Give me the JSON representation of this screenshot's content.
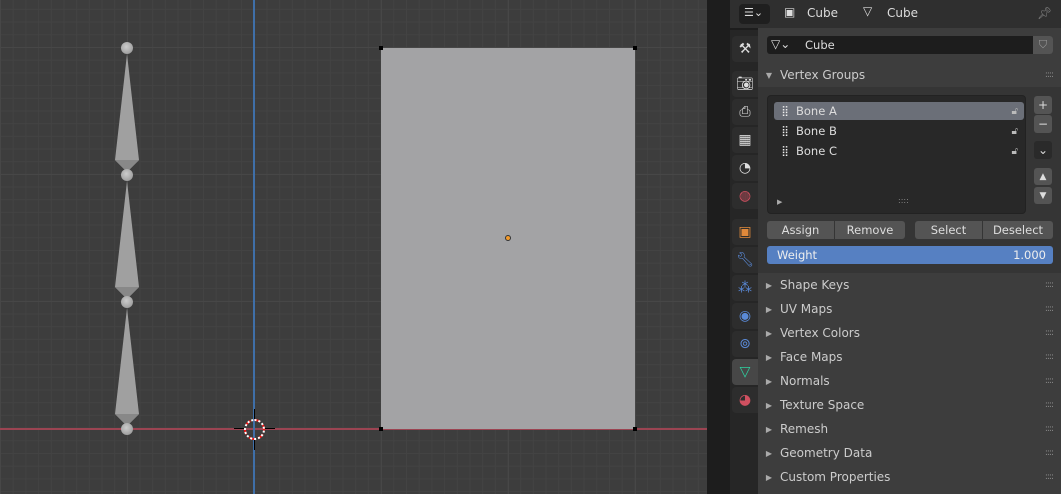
{
  "header": {
    "object_name": "Cube",
    "mesh_name": "Cube",
    "editor_icon": "properties-editor-icon",
    "pin_icon": "pin-icon"
  },
  "mesh_datablock": {
    "name": "Cube",
    "fake_user_icon": "shield-icon"
  },
  "vertex_groups": {
    "title": "Vertex Groups",
    "items": [
      {
        "name": "Bone A",
        "selected": true
      },
      {
        "name": "Bone B",
        "selected": false
      },
      {
        "name": "Bone C",
        "selected": false
      }
    ],
    "buttons": {
      "assign": "Assign",
      "remove": "Remove",
      "select": "Select",
      "deselect": "Deselect"
    },
    "weight": {
      "label": "Weight",
      "value": "1.000"
    }
  },
  "collapsed_panels": [
    "Shape Keys",
    "UV Maps",
    "Vertex Colors",
    "Face Maps",
    "Normals",
    "Texture Space",
    "Remesh",
    "Geometry Data",
    "Custom Properties"
  ],
  "tabs": [
    "tool",
    "render",
    "output",
    "view-layer",
    "scene",
    "world",
    "object",
    "modifiers",
    "particles",
    "physics",
    "constraints",
    "data",
    "material"
  ],
  "colors": {
    "accent": "#5680c2",
    "x_axis": "#9b4452",
    "y_axis": "#3f6fa8",
    "active_tab_icon": "#2fd0a0"
  }
}
